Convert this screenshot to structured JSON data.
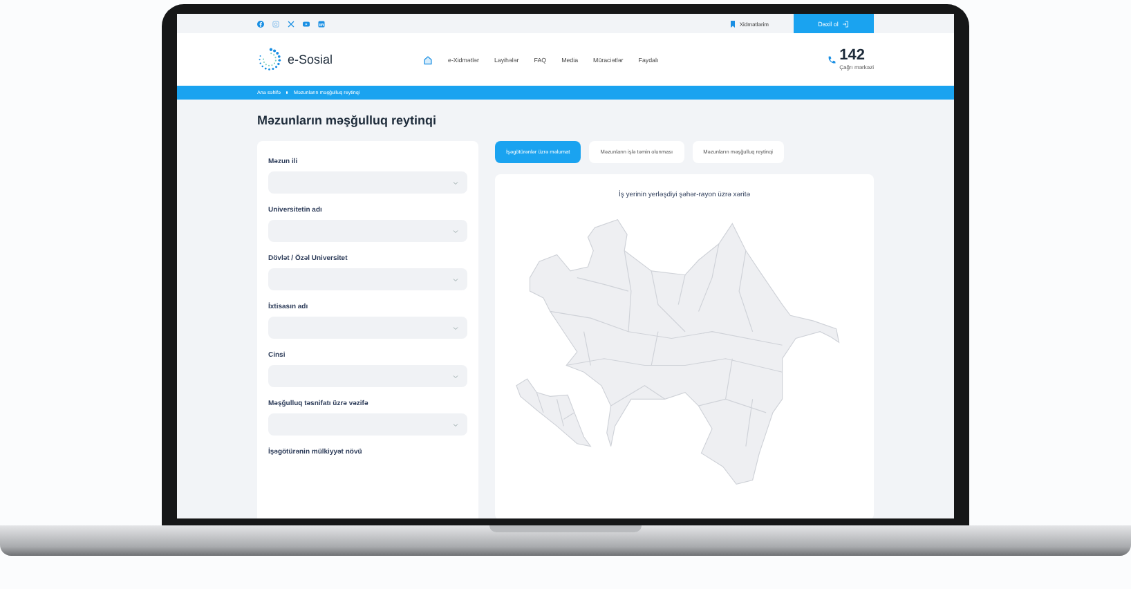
{
  "top_bar": {
    "services_link": "Xidmətlərim",
    "login_button": "Daxil ol"
  },
  "header": {
    "logo": "e-Sosial",
    "nav": [
      {
        "kind": "home",
        "selected": true
      },
      {
        "kind": "text",
        "label": "e-Xidmətlər",
        "selected": false
      },
      {
        "kind": "text",
        "label": "Layihələr",
        "selected": false
      },
      {
        "kind": "text",
        "label": "FAQ",
        "selected": false
      },
      {
        "kind": "text",
        "label": "Media",
        "selected": false
      },
      {
        "kind": "text",
        "label": "Müraciətlər",
        "selected": false
      },
      {
        "kind": "text",
        "label": "Faydalı",
        "selected": false
      }
    ],
    "phone": {
      "number": "142",
      "caption": "Çağrı mərkəzi"
    }
  },
  "breadcrumb": [
    "Ana səhifə",
    "Məzunların məşğulluq reytinqi"
  ],
  "page_title": "Məzunların məşğulluq reytinqi",
  "filters": [
    {
      "label": "Məzun ili",
      "kind": "dropdown"
    },
    {
      "label": "Universitetin adı",
      "kind": "dropdown"
    },
    {
      "label": "Dövlət / Özəl Universitet",
      "kind": "dropdown"
    },
    {
      "label": "İxtisasın adı",
      "kind": "dropdown"
    },
    {
      "label": "Cinsi",
      "kind": "dropdown"
    },
    {
      "label": "Məşğulluq təsnifatı üzrə vəzifə",
      "kind": "dropdown"
    },
    {
      "label": "İşəgötürənin mülkiyyət növü",
      "kind": "label"
    }
  ],
  "tabs": [
    {
      "label": "İşəgötürənlər üzrə məlumat",
      "selected": true
    },
    {
      "label": "Məzunların işlə təmin olunması",
      "selected": false
    },
    {
      "label": "Məzunların məşğulluq reytinqi",
      "selected": false
    }
  ],
  "map_card": {
    "title": "İş yerinin yerləşdiyi şəhər-rayon üzrə xəritə"
  }
}
